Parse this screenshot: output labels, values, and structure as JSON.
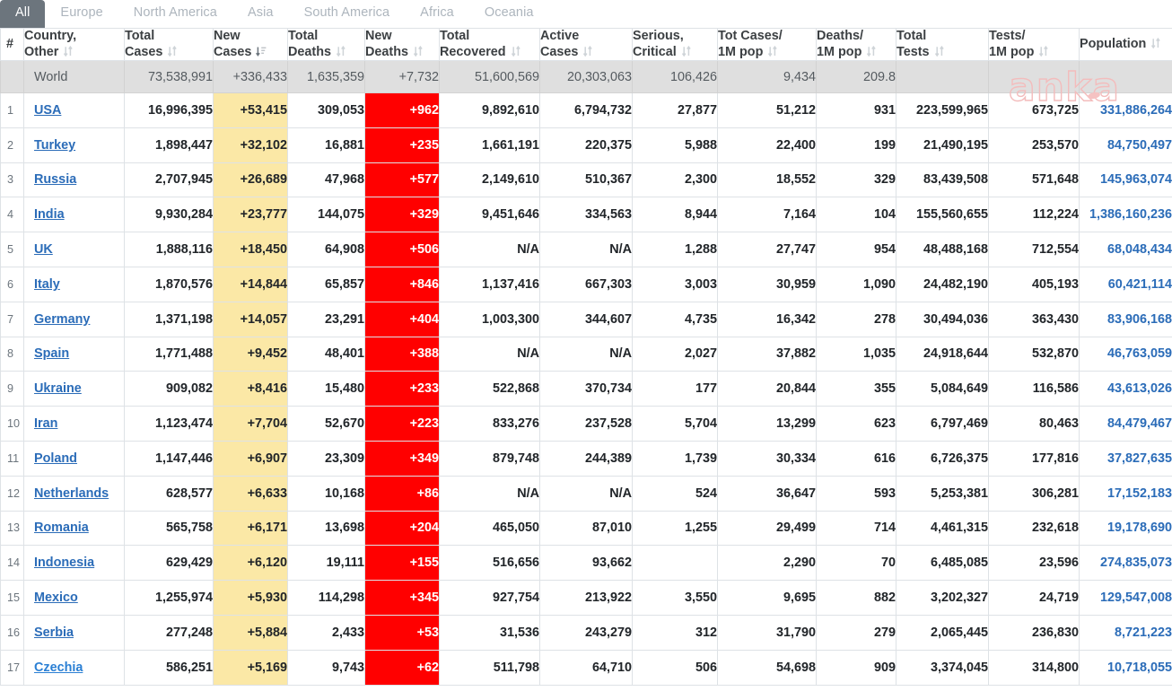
{
  "tabs": [
    {
      "label": "All",
      "active": true
    },
    {
      "label": "Europe",
      "active": false
    },
    {
      "label": "North America",
      "active": false
    },
    {
      "label": "Asia",
      "active": false
    },
    {
      "label": "South America",
      "active": false
    },
    {
      "label": "Africa",
      "active": false
    },
    {
      "label": "Oceania",
      "active": false
    }
  ],
  "watermark": "anka",
  "table": {
    "columns": [
      {
        "label": "#",
        "sort": "none",
        "key": "num"
      },
      {
        "label": "Country,\nOther",
        "line1": "Country,",
        "line2": "Other",
        "sort": "both",
        "key": "country"
      },
      {
        "label": "Total Cases",
        "line1": "Total",
        "line2": "Cases",
        "sort": "both",
        "key": "total_cases"
      },
      {
        "label": "New Cases",
        "line1": "New",
        "line2": "Cases",
        "sort": "desc",
        "key": "new_cases"
      },
      {
        "label": "Total Deaths",
        "line1": "Total",
        "line2": "Deaths",
        "sort": "both",
        "key": "total_deaths"
      },
      {
        "label": "New Deaths",
        "line1": "New",
        "line2": "Deaths",
        "sort": "both",
        "key": "new_deaths"
      },
      {
        "label": "Total Recovered",
        "line1": "Total",
        "line2": "Recovered",
        "sort": "both",
        "key": "total_recovered"
      },
      {
        "label": "Active Cases",
        "line1": "Active",
        "line2": "Cases",
        "sort": "both",
        "key": "active_cases"
      },
      {
        "label": "Serious, Critical",
        "line1": "Serious,",
        "line2": "Critical",
        "sort": "both",
        "key": "serious"
      },
      {
        "label": "Tot Cases/1M pop",
        "line1": "Tot Cases/",
        "line2": "1M pop",
        "sort": "both",
        "key": "cases_per_m"
      },
      {
        "label": "Deaths/1M pop",
        "line1": "Deaths/",
        "line2": "1M pop",
        "sort": "both",
        "key": "deaths_per_m"
      },
      {
        "label": "Total Tests",
        "line1": "Total",
        "line2": "Tests",
        "sort": "both",
        "key": "total_tests"
      },
      {
        "label": "Tests/1M pop",
        "line1": "Tests/",
        "line2": "1M pop",
        "sort": "both",
        "key": "tests_per_m"
      },
      {
        "label": "Population",
        "line1": "",
        "line2": "Population",
        "sort": "both",
        "key": "population"
      }
    ],
    "world": {
      "num": "",
      "country": "World",
      "total_cases": "73,538,991",
      "new_cases": "+336,433",
      "total_deaths": "1,635,359",
      "new_deaths": "+7,732",
      "total_recovered": "51,600,569",
      "active_cases": "20,303,063",
      "serious": "106,426",
      "cases_per_m": "9,434",
      "deaths_per_m": "209.8",
      "total_tests": "",
      "tests_per_m": "",
      "population": ""
    },
    "rows": [
      {
        "num": "1",
        "country": "USA",
        "total_cases": "16,996,395",
        "new_cases": "+53,415",
        "total_deaths": "309,053",
        "new_deaths": "+962",
        "total_recovered": "9,892,610",
        "active_cases": "6,794,732",
        "serious": "27,877",
        "cases_per_m": "51,212",
        "deaths_per_m": "931",
        "total_tests": "223,599,965",
        "tests_per_m": "673,725",
        "population": "331,886,264"
      },
      {
        "num": "2",
        "country": "Turkey",
        "total_cases": "1,898,447",
        "new_cases": "+32,102",
        "total_deaths": "16,881",
        "new_deaths": "+235",
        "total_recovered": "1,661,191",
        "active_cases": "220,375",
        "serious": "5,988",
        "cases_per_m": "22,400",
        "deaths_per_m": "199",
        "total_tests": "21,490,195",
        "tests_per_m": "253,570",
        "population": "84,750,497"
      },
      {
        "num": "3",
        "country": "Russia",
        "total_cases": "2,707,945",
        "new_cases": "+26,689",
        "total_deaths": "47,968",
        "new_deaths": "+577",
        "total_recovered": "2,149,610",
        "active_cases": "510,367",
        "serious": "2,300",
        "cases_per_m": "18,552",
        "deaths_per_m": "329",
        "total_tests": "83,439,508",
        "tests_per_m": "571,648",
        "population": "145,963,074"
      },
      {
        "num": "4",
        "country": "India",
        "total_cases": "9,930,284",
        "new_cases": "+23,777",
        "total_deaths": "144,075",
        "new_deaths": "+329",
        "total_recovered": "9,451,646",
        "active_cases": "334,563",
        "serious": "8,944",
        "cases_per_m": "7,164",
        "deaths_per_m": "104",
        "total_tests": "155,560,655",
        "tests_per_m": "112,224",
        "population": "1,386,160,236"
      },
      {
        "num": "5",
        "country": "UK",
        "total_cases": "1,888,116",
        "new_cases": "+18,450",
        "total_deaths": "64,908",
        "new_deaths": "+506",
        "total_recovered": "N/A",
        "active_cases": "N/A",
        "serious": "1,288",
        "cases_per_m": "27,747",
        "deaths_per_m": "954",
        "total_tests": "48,488,168",
        "tests_per_m": "712,554",
        "population": "68,048,434"
      },
      {
        "num": "6",
        "country": "Italy",
        "total_cases": "1,870,576",
        "new_cases": "+14,844",
        "total_deaths": "65,857",
        "new_deaths": "+846",
        "total_recovered": "1,137,416",
        "active_cases": "667,303",
        "serious": "3,003",
        "cases_per_m": "30,959",
        "deaths_per_m": "1,090",
        "total_tests": "24,482,190",
        "tests_per_m": "405,193",
        "population": "60,421,114"
      },
      {
        "num": "7",
        "country": "Germany",
        "total_cases": "1,371,198",
        "new_cases": "+14,057",
        "total_deaths": "23,291",
        "new_deaths": "+404",
        "total_recovered": "1,003,300",
        "active_cases": "344,607",
        "serious": "4,735",
        "cases_per_m": "16,342",
        "deaths_per_m": "278",
        "total_tests": "30,494,036",
        "tests_per_m": "363,430",
        "population": "83,906,168"
      },
      {
        "num": "8",
        "country": "Spain",
        "total_cases": "1,771,488",
        "new_cases": "+9,452",
        "total_deaths": "48,401",
        "new_deaths": "+388",
        "total_recovered": "N/A",
        "active_cases": "N/A",
        "serious": "2,027",
        "cases_per_m": "37,882",
        "deaths_per_m": "1,035",
        "total_tests": "24,918,644",
        "tests_per_m": "532,870",
        "population": "46,763,059"
      },
      {
        "num": "9",
        "country": "Ukraine",
        "total_cases": "909,082",
        "new_cases": "+8,416",
        "total_deaths": "15,480",
        "new_deaths": "+233",
        "total_recovered": "522,868",
        "active_cases": "370,734",
        "serious": "177",
        "cases_per_m": "20,844",
        "deaths_per_m": "355",
        "total_tests": "5,084,649",
        "tests_per_m": "116,586",
        "population": "43,613,026"
      },
      {
        "num": "10",
        "country": "Iran",
        "total_cases": "1,123,474",
        "new_cases": "+7,704",
        "total_deaths": "52,670",
        "new_deaths": "+223",
        "total_recovered": "833,276",
        "active_cases": "237,528",
        "serious": "5,704",
        "cases_per_m": "13,299",
        "deaths_per_m": "623",
        "total_tests": "6,797,469",
        "tests_per_m": "80,463",
        "population": "84,479,467"
      },
      {
        "num": "11",
        "country": "Poland",
        "total_cases": "1,147,446",
        "new_cases": "+6,907",
        "total_deaths": "23,309",
        "new_deaths": "+349",
        "total_recovered": "879,748",
        "active_cases": "244,389",
        "serious": "1,739",
        "cases_per_m": "30,334",
        "deaths_per_m": "616",
        "total_tests": "6,726,375",
        "tests_per_m": "177,816",
        "population": "37,827,635"
      },
      {
        "num": "12",
        "country": "Netherlands",
        "total_cases": "628,577",
        "new_cases": "+6,633",
        "total_deaths": "10,168",
        "new_deaths": "+86",
        "total_recovered": "N/A",
        "active_cases": "N/A",
        "serious": "524",
        "cases_per_m": "36,647",
        "deaths_per_m": "593",
        "total_tests": "5,253,381",
        "tests_per_m": "306,281",
        "population": "17,152,183"
      },
      {
        "num": "13",
        "country": "Romania",
        "total_cases": "565,758",
        "new_cases": "+6,171",
        "total_deaths": "13,698",
        "new_deaths": "+204",
        "total_recovered": "465,050",
        "active_cases": "87,010",
        "serious": "1,255",
        "cases_per_m": "29,499",
        "deaths_per_m": "714",
        "total_tests": "4,461,315",
        "tests_per_m": "232,618",
        "population": "19,178,690"
      },
      {
        "num": "14",
        "country": "Indonesia",
        "total_cases": "629,429",
        "new_cases": "+6,120",
        "total_deaths": "19,111",
        "new_deaths": "+155",
        "total_recovered": "516,656",
        "active_cases": "93,662",
        "serious": "",
        "cases_per_m": "2,290",
        "deaths_per_m": "70",
        "total_tests": "6,485,085",
        "tests_per_m": "23,596",
        "population": "274,835,073"
      },
      {
        "num": "15",
        "country": "Mexico",
        "total_cases": "1,255,974",
        "new_cases": "+5,930",
        "total_deaths": "114,298",
        "new_deaths": "+345",
        "total_recovered": "927,754",
        "active_cases": "213,922",
        "serious": "3,550",
        "cases_per_m": "9,695",
        "deaths_per_m": "882",
        "total_tests": "3,202,327",
        "tests_per_m": "24,719",
        "population": "129,547,008"
      },
      {
        "num": "16",
        "country": "Serbia",
        "total_cases": "277,248",
        "new_cases": "+5,884",
        "total_deaths": "2,433",
        "new_deaths": "+53",
        "total_recovered": "31,536",
        "active_cases": "243,279",
        "serious": "312",
        "cases_per_m": "31,790",
        "deaths_per_m": "279",
        "total_tests": "2,065,445",
        "tests_per_m": "236,830",
        "population": "8,721,223"
      },
      {
        "num": "17",
        "country": "Czechia",
        "total_cases": "586,251",
        "new_cases": "+5,169",
        "total_deaths": "9,743",
        "new_deaths": "+62",
        "total_recovered": "511,798",
        "active_cases": "64,710",
        "serious": "506",
        "cases_per_m": "54,698",
        "deaths_per_m": "909",
        "total_tests": "3,374,045",
        "tests_per_m": "314,800",
        "population": "10,718,055",
        "hover": true
      }
    ]
  }
}
